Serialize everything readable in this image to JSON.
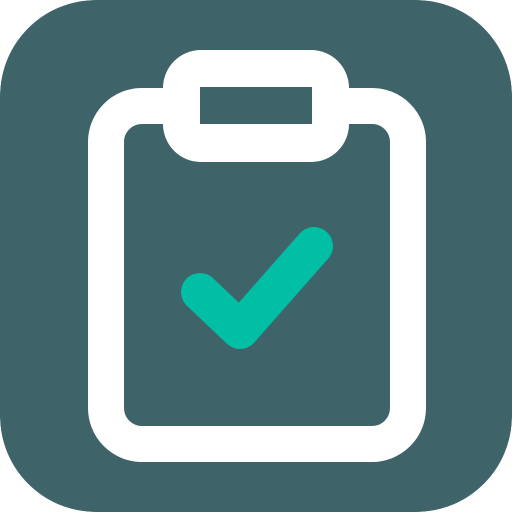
{
  "icon": {
    "name": "clipboard-check-icon",
    "background_color": "#3e6469",
    "outline_color": "#ffffff",
    "check_color": "#00bfa5"
  }
}
